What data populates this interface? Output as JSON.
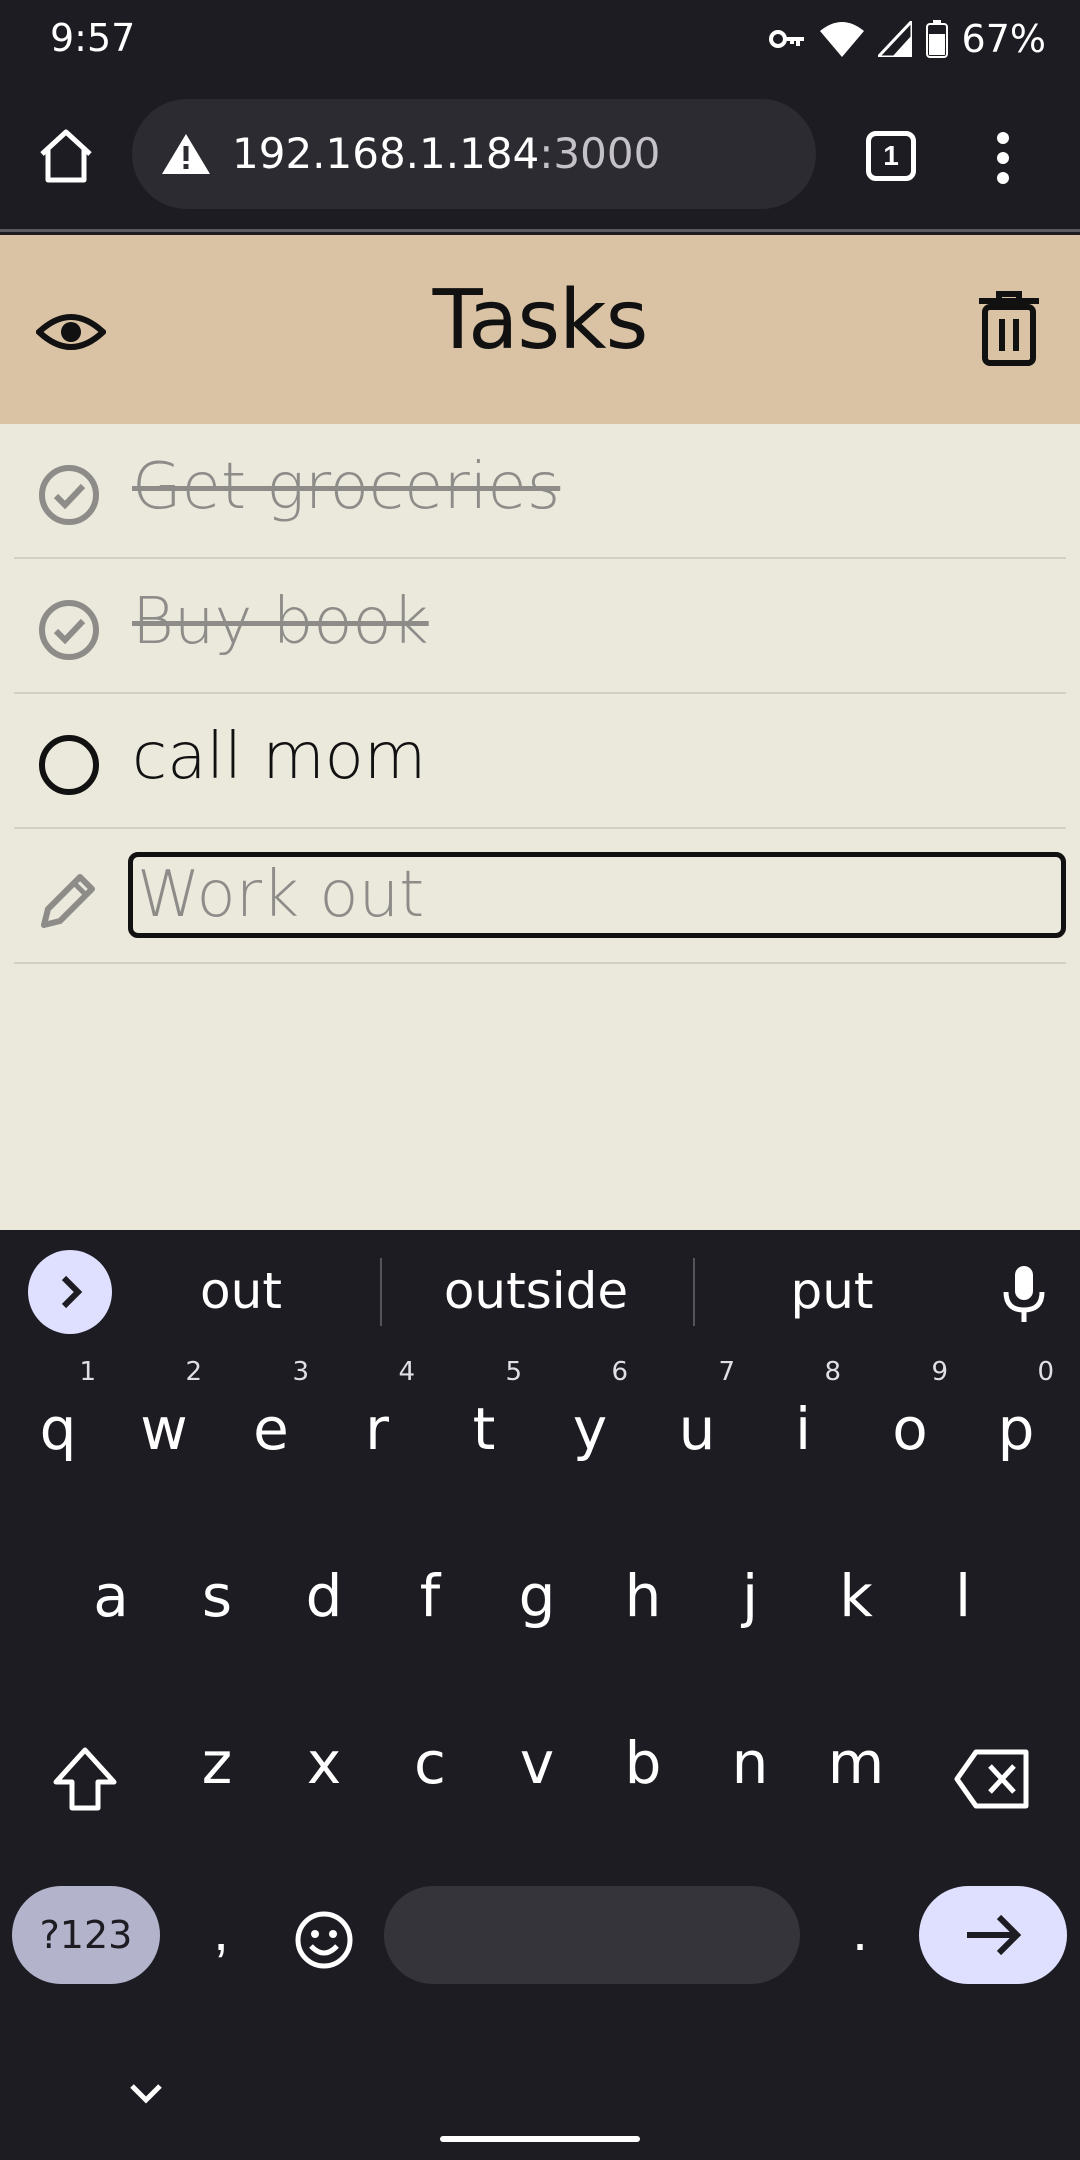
{
  "status_bar": {
    "time": "9:57",
    "battery": "67%"
  },
  "browser": {
    "url_host": "192.168.1.184",
    "url_port": ":3000",
    "tab_count": "1"
  },
  "app": {
    "title": "Tasks"
  },
  "tasks": [
    {
      "label": "Get groceries",
      "done": true
    },
    {
      "label": "Buy book",
      "done": true
    },
    {
      "label": "call mom",
      "done": false
    }
  ],
  "new_task": {
    "value": "",
    "placeholder": "Work out"
  },
  "keyboard": {
    "suggestions": [
      "out",
      "outside",
      "put"
    ],
    "row1": [
      {
        "ch": "q",
        "num": "1"
      },
      {
        "ch": "w",
        "num": "2"
      },
      {
        "ch": "e",
        "num": "3"
      },
      {
        "ch": "r",
        "num": "4"
      },
      {
        "ch": "t",
        "num": "5"
      },
      {
        "ch": "y",
        "num": "6"
      },
      {
        "ch": "u",
        "num": "7"
      },
      {
        "ch": "i",
        "num": "8"
      },
      {
        "ch": "o",
        "num": "9"
      },
      {
        "ch": "p",
        "num": "0"
      }
    ],
    "row2": [
      "a",
      "s",
      "d",
      "f",
      "g",
      "h",
      "j",
      "k",
      "l"
    ],
    "row3": [
      "z",
      "x",
      "c",
      "v",
      "b",
      "n",
      "m"
    ],
    "symbols_label": "?123",
    "comma": ",",
    "period": "."
  },
  "colors": {
    "header": "#d9c3a4",
    "list_bg": "#ebe8dc",
    "keyboard_bg": "#1d1c22",
    "accent_key": "#dfe0ff"
  }
}
